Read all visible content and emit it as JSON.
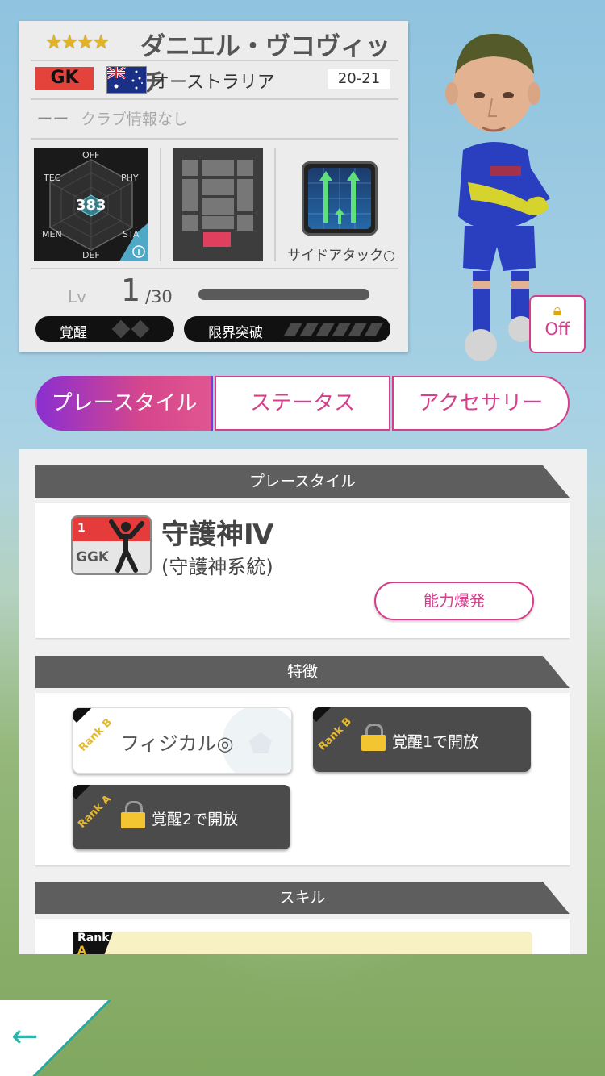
{
  "player": {
    "stars": "★★★★",
    "name": "ダニエル・ヴコヴィッチ",
    "position": "GK",
    "country": "オーストラリア",
    "season": "20-21",
    "club_dash": "ーー",
    "club": "クラブ情報なし",
    "hex": {
      "off": "OFF",
      "phy": "PHY",
      "sta": "STA",
      "def": "DEF",
      "men": "MEN",
      "tec": "TEC",
      "total": "383"
    },
    "skill_caption": "サイドアタック○",
    "level": {
      "label": "Lv",
      "value": "1",
      "max": "/30",
      "progress": 0
    },
    "awakening_label": "覚醒",
    "awakening_level": 0,
    "limit_label": "限界突破",
    "limit_level": 0
  },
  "lock_toggle": {
    "label": "Off",
    "icon": "lock-icon"
  },
  "tabs": [
    {
      "label": "プレースタイル",
      "active": true
    },
    {
      "label": "ステータス",
      "active": false
    },
    {
      "label": "アクセサリー",
      "active": false
    }
  ],
  "playstyle": {
    "header": "プレースタイル",
    "icon_number": "1",
    "icon_code": "GGK",
    "name": "守護神Ⅳ",
    "lineage": "(守護神系統)",
    "burst_button": "能力爆発"
  },
  "traits": {
    "header": "特徴",
    "items": [
      {
        "rank": "Rank B",
        "label": "フィジカル◎",
        "locked": false
      },
      {
        "rank": "Rank B",
        "label": "覚醒1で開放",
        "locked": true
      },
      {
        "rank": "Rank A",
        "label": "覚醒2で開放",
        "locked": true
      }
    ]
  },
  "skills": {
    "header": "スキル",
    "first_rank": "Rank",
    "first_rank_letter": "A"
  },
  "back_button": {
    "icon": "back-arrow-icon",
    "glyph": "←"
  },
  "colors": {
    "accent": "#d63e8a",
    "gk_badge": "#e4433b",
    "header_gray": "#5e5e5e"
  }
}
